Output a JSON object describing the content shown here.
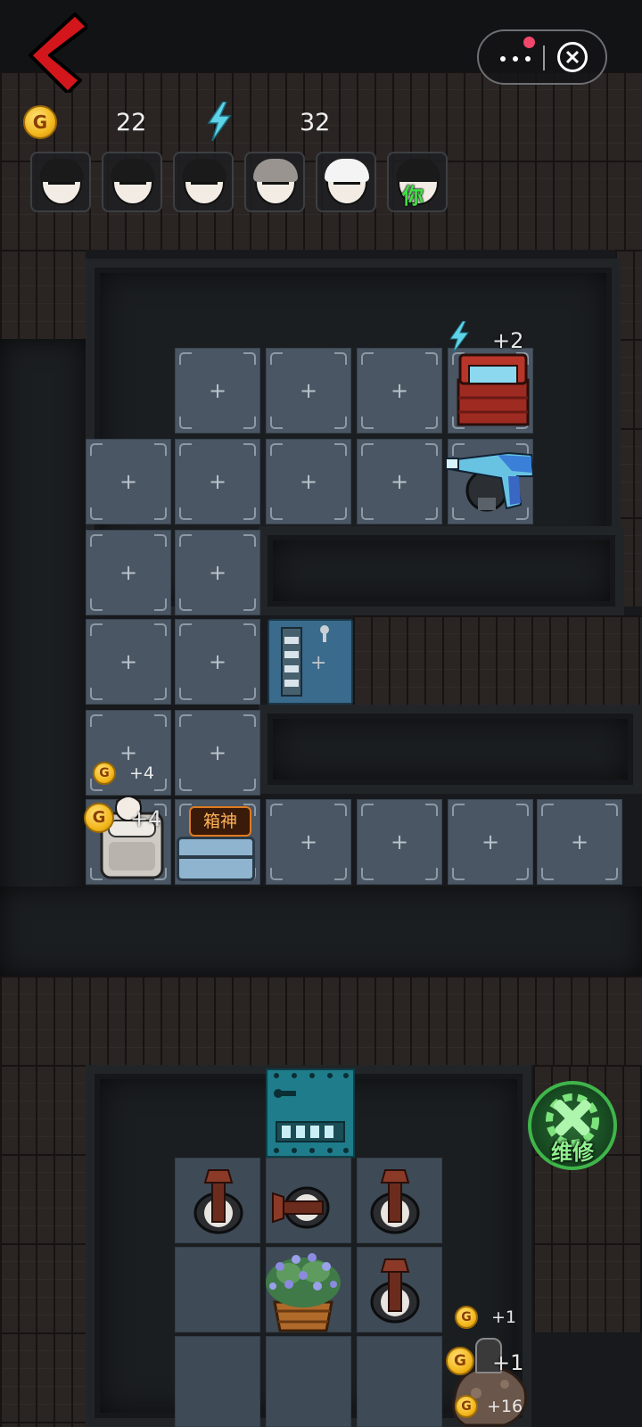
{
  "hud": {
    "gold_value": "22",
    "energy_value": "32",
    "coin_glyph": "G"
  },
  "players": [
    {
      "name": "player-1",
      "hair": "black"
    },
    {
      "name": "player-2",
      "hair": "black"
    },
    {
      "name": "player-3",
      "hair": "black"
    },
    {
      "name": "player-4",
      "hair": "grey"
    },
    {
      "name": "player-5",
      "hair": "white"
    },
    {
      "name": "player-you",
      "hair": "black",
      "label": "你"
    }
  ],
  "map": {
    "tile_plus": "+",
    "chest_bonus": "+2",
    "bed_coin_bonus_upper": "+4",
    "bed_coin_bonus_lower": "+4",
    "suitcase_tag": "箱神",
    "coin_bonus_1": "+1",
    "coin_bonus_2": "+1",
    "coin_bonus_3": "+16"
  },
  "actions": {
    "repair_label": "维修"
  },
  "colors": {
    "accent_red": "#d3161b",
    "energy_cyan": "#5fd3e8",
    "repair_green": "#3fb54a",
    "tag_orange": "#e07a1f"
  }
}
